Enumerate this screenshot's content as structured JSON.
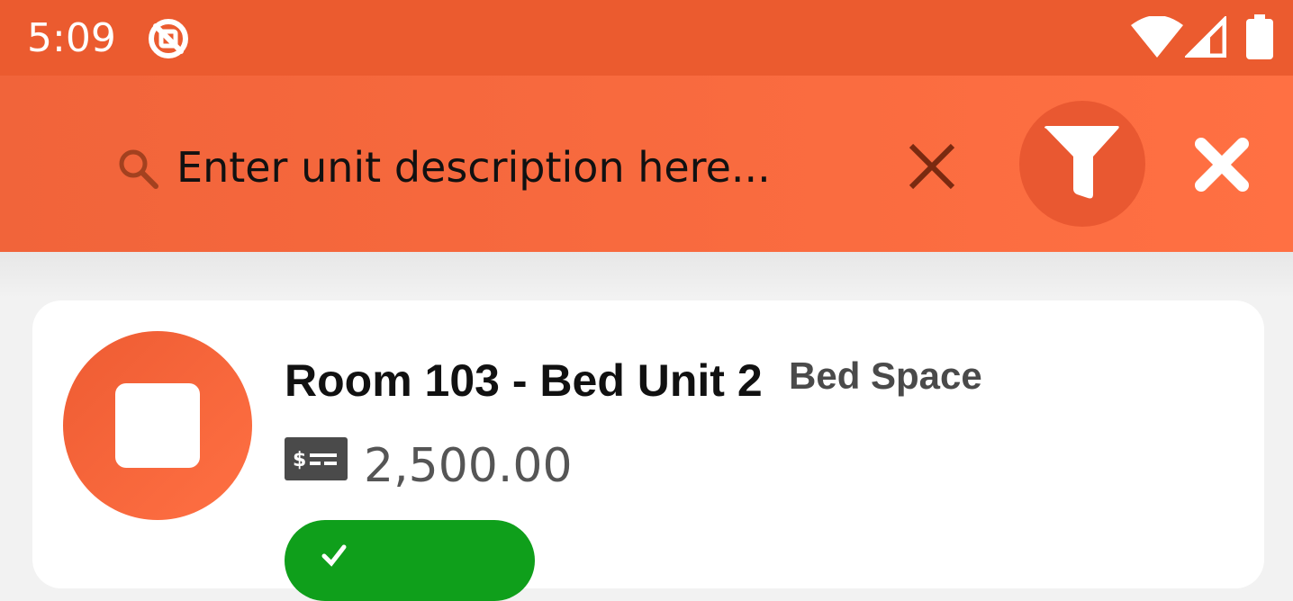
{
  "status_bar": {
    "time": "5:09",
    "app_icon": "no-lock-circle-icon",
    "icons": [
      "wifi-icon",
      "signal-icon",
      "battery-icon"
    ]
  },
  "search": {
    "placeholder": "Enter unit description here...",
    "value": "",
    "icons": {
      "search": "search-icon",
      "clear": "clear-x-icon",
      "filter": "filter-funnel-icon",
      "close": "close-x-icon"
    }
  },
  "unit_card": {
    "title": "Room 103 - Bed Unit 2",
    "type": "Bed Space",
    "price": "2,500.00",
    "avatar_icon": "stop-square-icon",
    "price_icon": "money-bill-icon",
    "status_label": ""
  },
  "colors": {
    "status_bar": "#eb5b2f",
    "toolbar_start": "#f1643a",
    "toolbar_end": "#ff7043",
    "accent_dark": "#e95831",
    "status_green": "#0f9f1b"
  }
}
